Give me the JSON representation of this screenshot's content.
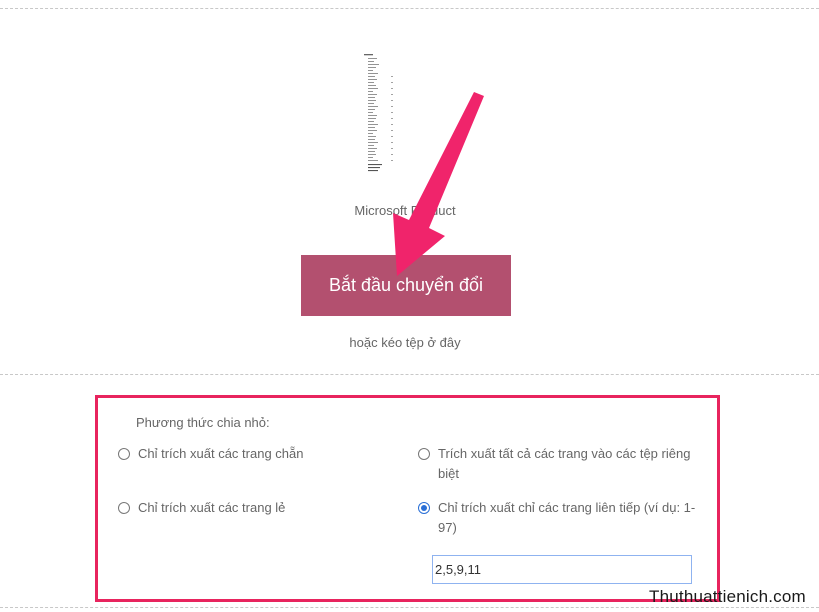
{
  "preview": {
    "file_name": "Microsoft Product"
  },
  "actions": {
    "start_label": "Bắt đầu chuyển đổi",
    "drag_hint": "hoặc kéo tệp ở đây"
  },
  "split_options": {
    "label": "Phương thức chia nhỏ:",
    "options": [
      {
        "label": "Chỉ trích xuất các trang chẵn",
        "checked": false
      },
      {
        "label": "Trích xuất tất cả các trang vào các tệp riêng biệt",
        "checked": false
      },
      {
        "label": "Chỉ trích xuất các trang lẻ",
        "checked": false
      },
      {
        "label": "Chỉ trích xuất chỉ các trang liên tiếp (ví dụ: 1-97)",
        "checked": true
      }
    ],
    "pages_value": "2,5,9,11"
  },
  "watermark": "Thuthuattienich.com",
  "colors": {
    "button": "#b3506f",
    "highlight": "#e8245e",
    "radio_selected": "#2a6fd6"
  }
}
